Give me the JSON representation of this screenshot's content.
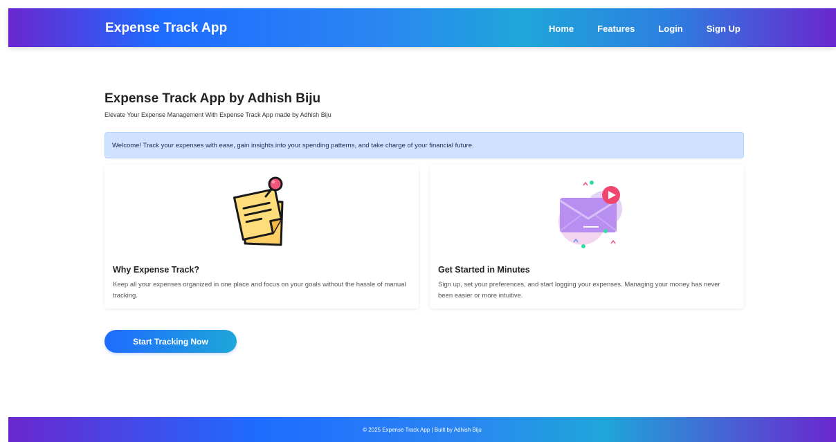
{
  "navbar": {
    "brand": "Expense Track App",
    "links": [
      "Home",
      "Features",
      "Login",
      "Sign Up"
    ]
  },
  "hero": {
    "title": "Expense Track App by Adhish Biju",
    "subtitle": "Elevate Your Expense Management With Expense Track App made by Adhish Biju",
    "alert": "Welcome! Track your expenses with ease, gain insights into your spending patterns, and take charge of your financial future."
  },
  "cards": [
    {
      "icon": "sticky-note-icon",
      "title": "Why Expense Track?",
      "text": "Keep all your expenses organized in one place and focus on your goals without the hassle of manual tracking."
    },
    {
      "icon": "envelope-icon",
      "title": "Get Started in Minutes",
      "text": "Sign up, set your preferences, and start logging your expenses. Managing your money has never been easier or more intuitive."
    }
  ],
  "cta": {
    "label": "Start Tracking Now"
  },
  "footer": {
    "text": "© 2025 Expense Track App | Built by Adhish Biju"
  },
  "colors": {
    "accent_blue": "#1f6bff",
    "accent_purple": "#6a27cf",
    "accent_cyan": "#1ea6d9",
    "alert_bg": "#cfe2ff"
  }
}
